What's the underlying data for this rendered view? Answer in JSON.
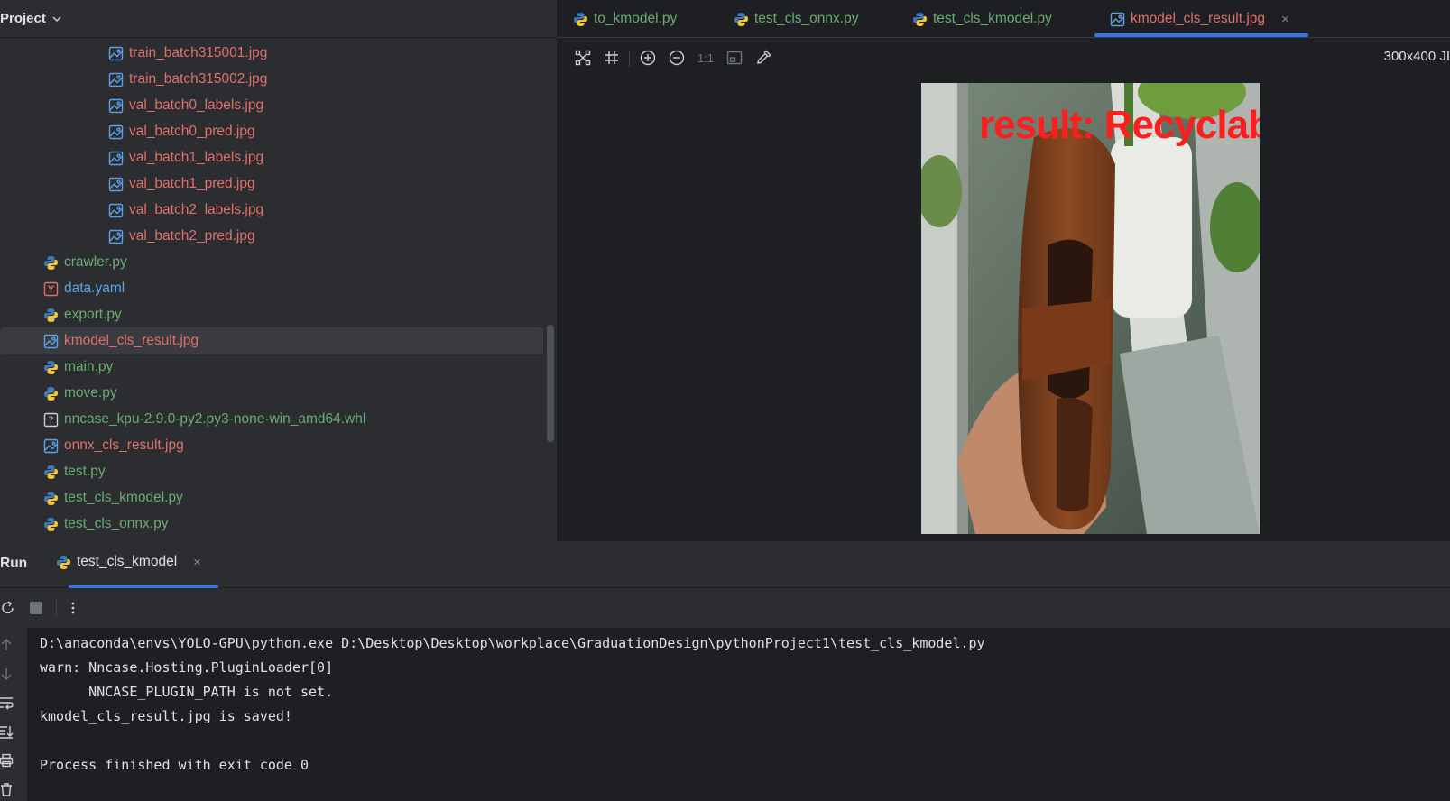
{
  "project": {
    "title": "Project",
    "items": [
      {
        "name": "train_batch315001.jpg",
        "type": "image",
        "indent": 2
      },
      {
        "name": "train_batch315002.jpg",
        "type": "image",
        "indent": 2
      },
      {
        "name": "val_batch0_labels.jpg",
        "type": "image",
        "indent": 2
      },
      {
        "name": "val_batch0_pred.jpg",
        "type": "image",
        "indent": 2
      },
      {
        "name": "val_batch1_labels.jpg",
        "type": "image",
        "indent": 2
      },
      {
        "name": "val_batch1_pred.jpg",
        "type": "image",
        "indent": 2
      },
      {
        "name": "val_batch2_labels.jpg",
        "type": "image",
        "indent": 2
      },
      {
        "name": "val_batch2_pred.jpg",
        "type": "image",
        "indent": 2
      },
      {
        "name": "crawler.py",
        "type": "python",
        "indent": 1
      },
      {
        "name": "data.yaml",
        "type": "yaml",
        "indent": 1
      },
      {
        "name": "export.py",
        "type": "python",
        "indent": 1
      },
      {
        "name": "kmodel_cls_result.jpg",
        "type": "image",
        "indent": 1,
        "selected": true
      },
      {
        "name": "main.py",
        "type": "python",
        "indent": 1
      },
      {
        "name": "move.py",
        "type": "python",
        "indent": 1
      },
      {
        "name": "nncase_kpu-2.9.0-py2.py3-none-win_amd64.whl",
        "type": "unknown",
        "indent": 1
      },
      {
        "name": "onnx_cls_result.jpg",
        "type": "image",
        "indent": 1
      },
      {
        "name": "test.py",
        "type": "python",
        "indent": 1
      },
      {
        "name": "test_cls_kmodel.py",
        "type": "python",
        "indent": 1
      },
      {
        "name": "test_cls_onnx.py",
        "type": "python",
        "indent": 1
      }
    ]
  },
  "editor": {
    "tabs": [
      {
        "label": "to_kmodel.py",
        "type": "python"
      },
      {
        "label": "test_cls_onnx.py",
        "type": "python"
      },
      {
        "label": "test_cls_kmodel.py",
        "type": "python"
      },
      {
        "label": "kmodel_cls_result.jpg",
        "type": "image",
        "active": true
      }
    ],
    "close_symbol": "×",
    "zoom_actual": "1:1",
    "image_size": "300x400 JI",
    "image_overlay_text": "result:  Recyclab"
  },
  "run": {
    "label": "Run",
    "tab_label": "test_cls_kmodel",
    "tab_close": "×",
    "console": [
      "D:\\anaconda\\envs\\YOLO-GPU\\python.exe D:\\Desktop\\Desktop\\workplace\\GraduationDesign\\pythonProject1\\test_cls_kmodel.py",
      "warn: Nncase.Hosting.PluginLoader[0]",
      "      NNCASE_PLUGIN_PATH is not set.",
      "kmodel_cls_result.jpg is saved!",
      "",
      "Process finished with exit code 0"
    ]
  },
  "colors": {
    "accent": "#3574f0",
    "image_file": "#e0706b",
    "python_file": "#6aab73",
    "yaml_file": "#5ea1e8",
    "overlay_text": "#ff1e1e"
  }
}
